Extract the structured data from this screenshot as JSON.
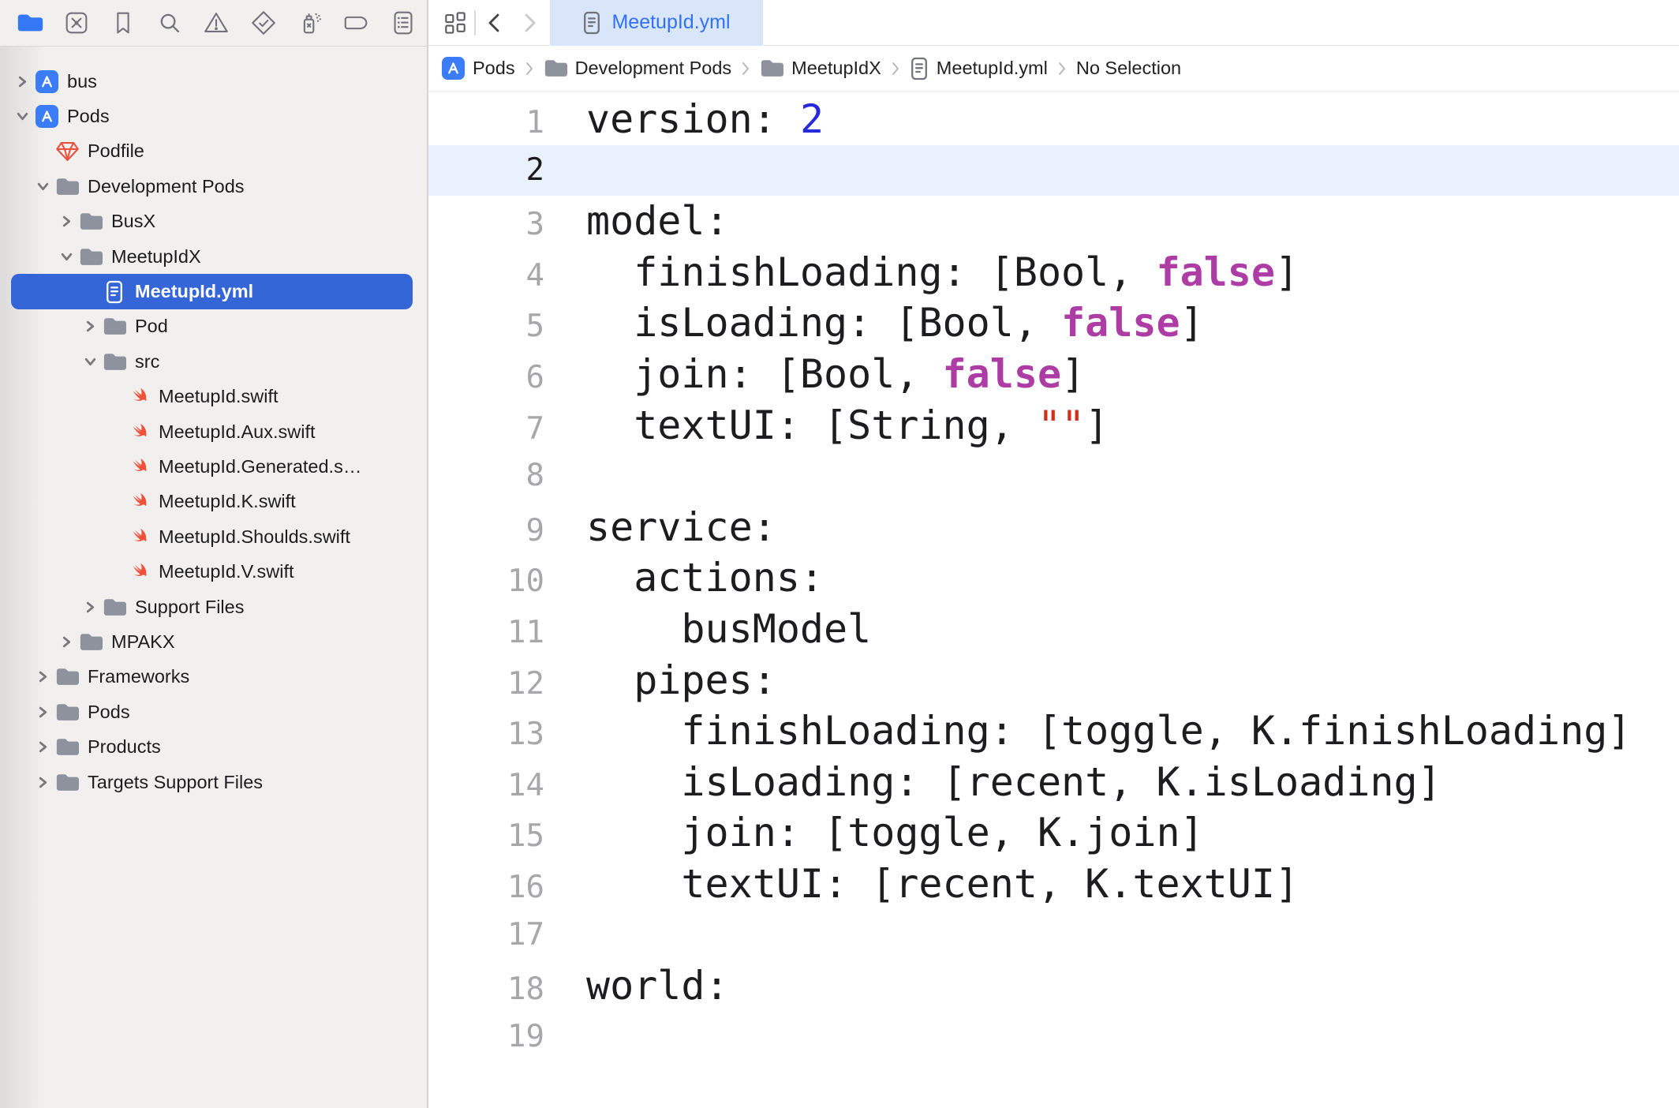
{
  "toolbar": {
    "icons": [
      {
        "name": "project-navigator-icon",
        "active": true
      },
      {
        "name": "crash-navigator-icon",
        "active": false
      },
      {
        "name": "bookmark-navigator-icon",
        "active": false
      },
      {
        "name": "find-navigator-icon",
        "active": false
      },
      {
        "name": "issue-navigator-icon",
        "active": false
      },
      {
        "name": "test-navigator-icon",
        "active": false
      },
      {
        "name": "debug-navigator-icon",
        "active": false
      },
      {
        "name": "breakpoint-navigator-icon",
        "active": false
      },
      {
        "name": "report-navigator-icon",
        "active": false
      }
    ]
  },
  "editor_nav": {
    "back_enabled": true,
    "forward_enabled": false
  },
  "tab": {
    "label": "MeetupId.yml",
    "icon": "doc-icon"
  },
  "breadcrumb": {
    "items": [
      {
        "label": "Pods",
        "icon": "app-icon"
      },
      {
        "label": "Development Pods",
        "icon": "folder-icon"
      },
      {
        "label": "MeetupIdX",
        "icon": "folder-icon"
      },
      {
        "label": "MeetupId.yml",
        "icon": "doc-icon"
      },
      {
        "label": "No Selection",
        "icon": null
      }
    ]
  },
  "sidebar": {
    "items": [
      {
        "label": "bus",
        "level": 1,
        "chevron": "collapsed",
        "icon": "app-icon",
        "selected": false
      },
      {
        "label": "Pods",
        "level": 1,
        "chevron": "expanded",
        "icon": "app-icon",
        "selected": false
      },
      {
        "label": "Podfile",
        "level": 2,
        "chevron": "none",
        "icon": "gem-icon",
        "selected": false
      },
      {
        "label": "Development Pods",
        "level": 2,
        "chevron": "expanded",
        "icon": "folder-icon",
        "selected": false
      },
      {
        "label": "BusX",
        "level": 3,
        "chevron": "collapsed",
        "icon": "folder-icon",
        "selected": false
      },
      {
        "label": "MeetupIdX",
        "level": 3,
        "chevron": "expanded",
        "icon": "folder-icon",
        "selected": false
      },
      {
        "label": "MeetupId.yml",
        "level": 4,
        "chevron": "none",
        "icon": "doc-icon",
        "selected": true
      },
      {
        "label": "Pod",
        "level": 4,
        "chevron": "collapsed",
        "icon": "folder-icon",
        "selected": false
      },
      {
        "label": "src",
        "level": 4,
        "chevron": "expanded",
        "icon": "folder-icon",
        "selected": false
      },
      {
        "label": "MeetupId.swift",
        "level": 5,
        "chevron": "none",
        "icon": "swift-icon",
        "selected": false
      },
      {
        "label": "MeetupId.Aux.swift",
        "level": 5,
        "chevron": "none",
        "icon": "swift-icon",
        "selected": false
      },
      {
        "label": "MeetupId.Generated.s…",
        "level": 5,
        "chevron": "none",
        "icon": "swift-icon",
        "selected": false
      },
      {
        "label": "MeetupId.K.swift",
        "level": 5,
        "chevron": "none",
        "icon": "swift-icon",
        "selected": false
      },
      {
        "label": "MeetupId.Shoulds.swift",
        "level": 5,
        "chevron": "none",
        "icon": "swift-icon",
        "selected": false
      },
      {
        "label": "MeetupId.V.swift",
        "level": 5,
        "chevron": "none",
        "icon": "swift-icon",
        "selected": false
      },
      {
        "label": "Support Files",
        "level": 4,
        "chevron": "collapsed",
        "icon": "folder-icon",
        "selected": false
      },
      {
        "label": "MPAKX",
        "level": 3,
        "chevron": "collapsed",
        "icon": "folder-icon",
        "selected": false
      },
      {
        "label": "Frameworks",
        "level": 2,
        "chevron": "collapsed",
        "icon": "folder-icon",
        "selected": false
      },
      {
        "label": "Pods",
        "level": 2,
        "chevron": "collapsed",
        "icon": "folder-icon",
        "selected": false
      },
      {
        "label": "Products",
        "level": 2,
        "chevron": "collapsed",
        "icon": "folder-icon",
        "selected": false
      },
      {
        "label": "Targets Support Files",
        "level": 2,
        "chevron": "collapsed",
        "icon": "folder-icon",
        "selected": false
      }
    ]
  },
  "editor": {
    "active_line": 2,
    "lines": [
      {
        "n": 1,
        "segments": [
          {
            "t": "version: ",
            "k": "plain"
          },
          {
            "t": "2",
            "k": "number"
          }
        ]
      },
      {
        "n": 2,
        "segments": []
      },
      {
        "n": 3,
        "segments": [
          {
            "t": "model:",
            "k": "plain"
          }
        ]
      },
      {
        "n": 4,
        "segments": [
          {
            "t": "  finishLoading: [Bool, ",
            "k": "plain"
          },
          {
            "t": "false",
            "k": "keyword"
          },
          {
            "t": "]",
            "k": "plain"
          }
        ]
      },
      {
        "n": 5,
        "segments": [
          {
            "t": "  isLoading: [Bool, ",
            "k": "plain"
          },
          {
            "t": "false",
            "k": "keyword"
          },
          {
            "t": "]",
            "k": "plain"
          }
        ]
      },
      {
        "n": 6,
        "segments": [
          {
            "t": "  join: [Bool, ",
            "k": "plain"
          },
          {
            "t": "false",
            "k": "keyword"
          },
          {
            "t": "]",
            "k": "plain"
          }
        ]
      },
      {
        "n": 7,
        "segments": [
          {
            "t": "  textUI: [String, ",
            "k": "plain"
          },
          {
            "t": "\"\"",
            "k": "string"
          },
          {
            "t": "]",
            "k": "plain"
          }
        ]
      },
      {
        "n": 8,
        "segments": []
      },
      {
        "n": 9,
        "segments": [
          {
            "t": "service:",
            "k": "plain"
          }
        ]
      },
      {
        "n": 10,
        "segments": [
          {
            "t": "  actions:",
            "k": "plain"
          }
        ]
      },
      {
        "n": 11,
        "segments": [
          {
            "t": "    busModel",
            "k": "plain"
          }
        ]
      },
      {
        "n": 12,
        "segments": [
          {
            "t": "  pipes:",
            "k": "plain"
          }
        ]
      },
      {
        "n": 13,
        "segments": [
          {
            "t": "    finishLoading: [toggle, K.finishLoading]",
            "k": "plain"
          }
        ]
      },
      {
        "n": 14,
        "segments": [
          {
            "t": "    isLoading: [recent, K.isLoading]",
            "k": "plain"
          }
        ]
      },
      {
        "n": 15,
        "segments": [
          {
            "t": "    join: [toggle, K.join]",
            "k": "plain"
          }
        ]
      },
      {
        "n": 16,
        "segments": [
          {
            "t": "    textUI: [recent, K.textUI]",
            "k": "plain"
          }
        ]
      },
      {
        "n": 17,
        "segments": []
      },
      {
        "n": 18,
        "segments": [
          {
            "t": "world:",
            "k": "plain"
          }
        ]
      },
      {
        "n": 19,
        "segments": []
      }
    ]
  },
  "colors": {
    "accent_blue": "#3478f6",
    "selection_blue": "#3566d8",
    "tab_background": "#d9e6f9",
    "tab_text": "#3171f5",
    "current_line": "#e9f1fc",
    "number_blue": "#272ad8",
    "keyword_pink": "#ad3da4",
    "string_red": "#d12f1b",
    "swift_orange": "#f05138",
    "gem_red": "#e8513d",
    "folder_gray": "#8d929c"
  }
}
